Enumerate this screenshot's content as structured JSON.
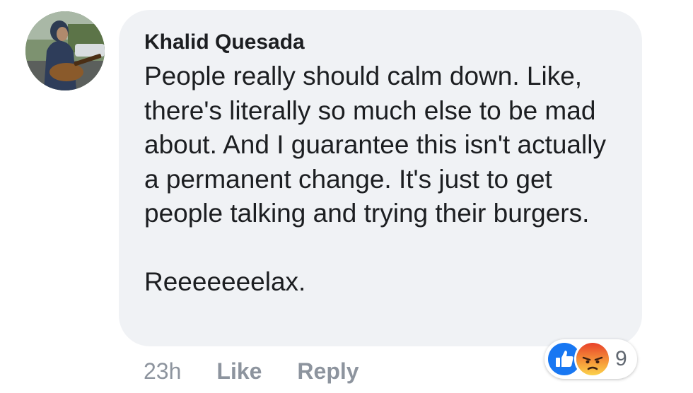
{
  "comment": {
    "author": "Khalid Quesada",
    "paragraphs": [
      "People really should calm down. Like, there's literally so much else to be mad about. And I guarantee this isn't actually a permanent change. It's just to get people talking and trying their burgers.",
      "Reeeeeeelax."
    ],
    "avatar_icon": "profile-photo-person-with-guitar"
  },
  "actions": {
    "timestamp": "23h",
    "like_label": "Like",
    "reply_label": "Reply"
  },
  "reactions": {
    "icons": [
      "like-icon",
      "angry-icon"
    ],
    "count": "9",
    "like_color": "#1877f2",
    "angry_color": "#f0553a"
  },
  "colors": {
    "bubble": "#f0f2f5",
    "text": "#1c1e21",
    "meta": "#8d949e"
  }
}
